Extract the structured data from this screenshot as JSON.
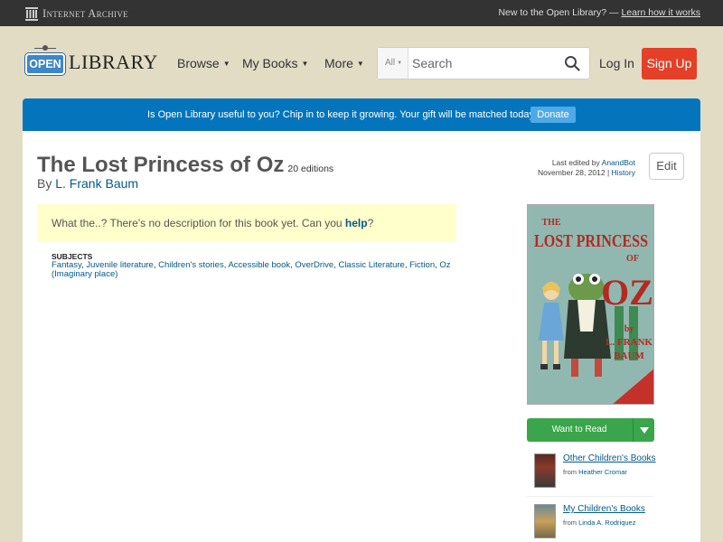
{
  "topbar": {
    "brand": "Internet Archive",
    "new_text": "New to the Open Library? —",
    "learn_link": "Learn how it works"
  },
  "header": {
    "logo_open": "OPEN",
    "logo_library": "LIBRARY",
    "nav": [
      {
        "label": "Browse"
      },
      {
        "label": "My Books"
      },
      {
        "label": "More"
      }
    ],
    "search": {
      "type": "All",
      "placeholder": "Search"
    },
    "login": "Log In",
    "signup": "Sign Up"
  },
  "banner": {
    "text": "Is Open Library useful to you? Chip in to keep it growing. Your gift will be matched today!",
    "button": "Donate"
  },
  "book": {
    "title": "The Lost Princess of Oz",
    "editions": "20 editions",
    "by": "By",
    "author": "L. Frank Baum",
    "last_edited_prefix": "Last edited by",
    "last_edited_user": "AnandBot",
    "last_edited_date": "November 28, 2012",
    "history": "History",
    "edit": "Edit",
    "no_desc": "What the..? There's no description for this book yet. Can you",
    "help": "help",
    "no_desc_end": "?",
    "subjects_title": "SUBJECTS",
    "subjects": [
      "Fantasy",
      "Juvenile literature",
      "Children's stories",
      "Accessible book",
      "OverDrive",
      "Classic Literature",
      "Fiction",
      "Oz (Imaginary place)"
    ],
    "cover": {
      "line1": "THE",
      "line2": "LOST PRINCESS",
      "line3": "OF",
      "line4": "OZ",
      "by": "by",
      "author1": "L. FRANK",
      "author2": "BAUM"
    }
  },
  "sidebar": {
    "want_to_read": "Want to Read",
    "lists": [
      {
        "name": "Other Children's Books",
        "from": "from",
        "user": "Heather Cromar"
      },
      {
        "name": "My Children's Books",
        "from": "from",
        "user": "Linda A. Rodriquez"
      }
    ]
  },
  "colors": {
    "brand_blue": "#0475bc",
    "signup_red": "#e44028",
    "want_green": "#3aa54b",
    "page_bg": "#e2dcc5"
  }
}
